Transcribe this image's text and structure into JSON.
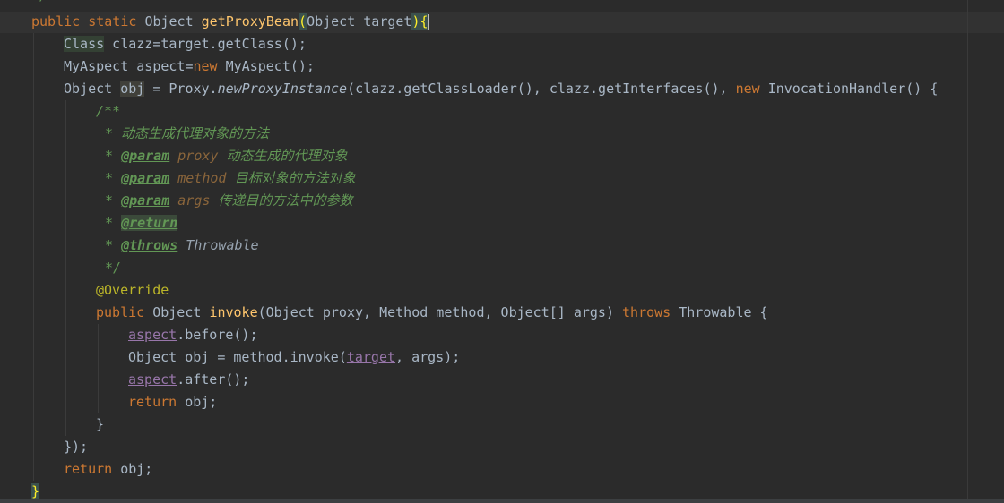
{
  "editor": {
    "prev_line_tail": "*/",
    "lines": {
      "l1": {
        "kw_public": "public",
        "kw_static": "static",
        "type": "Object",
        "method": "getProxyBean",
        "open_paren": "(",
        "params": "Object target",
        "close_paren": ")",
        "open_brace": "{"
      },
      "l2": {
        "type": "Class",
        "rest": " clazz=target.getClass();"
      },
      "l3": {
        "start": "MyAspect aspect=",
        "kw_new": "new",
        "rest": " MyAspect();"
      },
      "l4": {
        "type": "Object ",
        "var": "obj",
        "mid": " = Proxy.",
        "method": "newProxyInstance",
        "args": "(clazz.getClassLoader(), clazz.getInterfaces(), ",
        "kw_new": "new",
        "rest": " InvocationHandler() {"
      },
      "c1": "/**",
      "c2": "* 动态生成代理对象的方法",
      "c3": {
        "star": "* ",
        "tag": "@param",
        "name": " proxy",
        "desc": " 动态生成的代理对象"
      },
      "c4": {
        "star": "* ",
        "tag": "@param",
        "name": " method",
        "desc": " 目标对象的方法对象"
      },
      "c5": {
        "star": "* ",
        "tag": "@param",
        "name": " args",
        "desc": " 传递目的方法中的参数"
      },
      "c6": {
        "star": "* ",
        "tag": "@return"
      },
      "c7": {
        "star": "* ",
        "tag": "@throws",
        "type": " Throwable"
      },
      "c8": "*/",
      "l5": "@Override",
      "l6": {
        "kw_public": "public",
        "type": " Object ",
        "method": "invoke",
        "params": "(Object proxy, Method method, Object[] args) ",
        "kw_throws": "throws",
        "rest": " Throwable {"
      },
      "l7": {
        "field": "aspect",
        "rest": ".before();"
      },
      "l8": {
        "start": "Object obj = method.invoke(",
        "field": "target",
        "rest": ", args);"
      },
      "l9": {
        "field": "aspect",
        "rest": ".after();"
      },
      "l10": {
        "kw_return": "return",
        "rest": " obj;"
      },
      "l11": "}",
      "l12": "});",
      "l13": {
        "kw_return": "return",
        "rest": " obj;"
      },
      "l14": "}"
    }
  }
}
